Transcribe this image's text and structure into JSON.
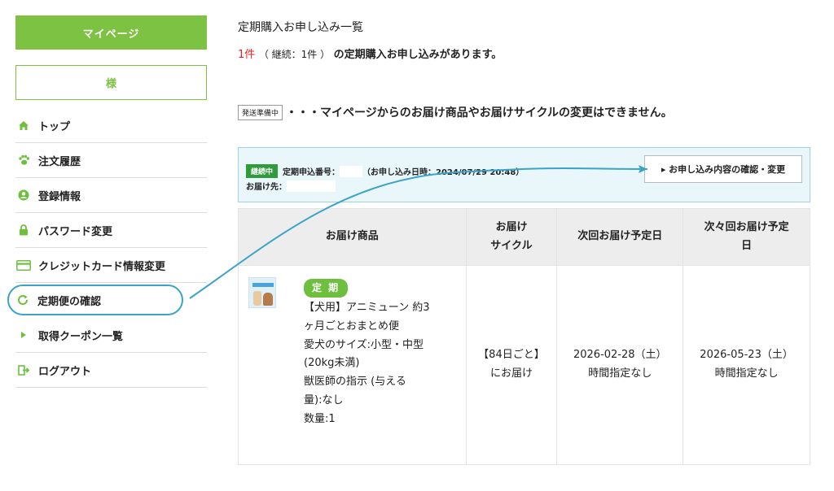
{
  "sidebar": {
    "mypage_label": "マイページ",
    "user_name_label": "様",
    "items": [
      {
        "label": "トップ",
        "icon": "home-icon"
      },
      {
        "label": "注文履歴",
        "icon": "paw-icon"
      },
      {
        "label": "登録情報",
        "icon": "user-circle-icon"
      },
      {
        "label": "パスワード変更",
        "icon": "lock-icon"
      },
      {
        "label": "クレジットカード情報変更",
        "icon": "credit-card-icon"
      },
      {
        "label": "定期便の確認",
        "icon": "refresh-icon"
      },
      {
        "label": "取得クーポン一覧",
        "icon": "triangle-right-icon"
      },
      {
        "label": "ログアウト",
        "icon": "logout-icon"
      }
    ]
  },
  "main": {
    "title": "定期購入お申し込み一覧",
    "summary_count": "1件",
    "summary_paren": "（ 継続：1件 ）",
    "summary_rest": "の定期購入お申し込みがあります。",
    "legend_tag": "発送準備中",
    "legend_text": "・・・マイページからのお届け商品やお届けサイクルの変更はできません。",
    "contract": {
      "status_badge": "継続中",
      "number_label": "定期申込番号：",
      "applied_at": "（お申し込み日時：2024/07/29 20:48）",
      "delivery_label": "お届け先：",
      "confirm_button": "▸ お申し込み内容の確認・変更"
    },
    "table": {
      "headers": [
        "お届け商品",
        "お届け\nサイクル",
        "次回お届け予定日",
        "次々回お届け予定\n日"
      ],
      "row": {
        "badge": "定 期",
        "product_lines": "【犬用】アニミューン 約3\nヶ月ごとおまとめ便\n愛犬のサイズ:小型・中型\n(20kg未満)\n獣医師の指示 (与える\n量):なし\n数量:1",
        "cycle": "【84日ごと】\nにお届け",
        "next_date": "2026-02-28（土）\n時間指定なし",
        "next_next_date": "2026-05-23（土）\n時間指定なし"
      }
    }
  },
  "colors": {
    "brand_green": "#7dc242",
    "badge_green": "#2f9b3c",
    "highlight_blue": "#3aa3c9",
    "count_red": "#e02020"
  }
}
